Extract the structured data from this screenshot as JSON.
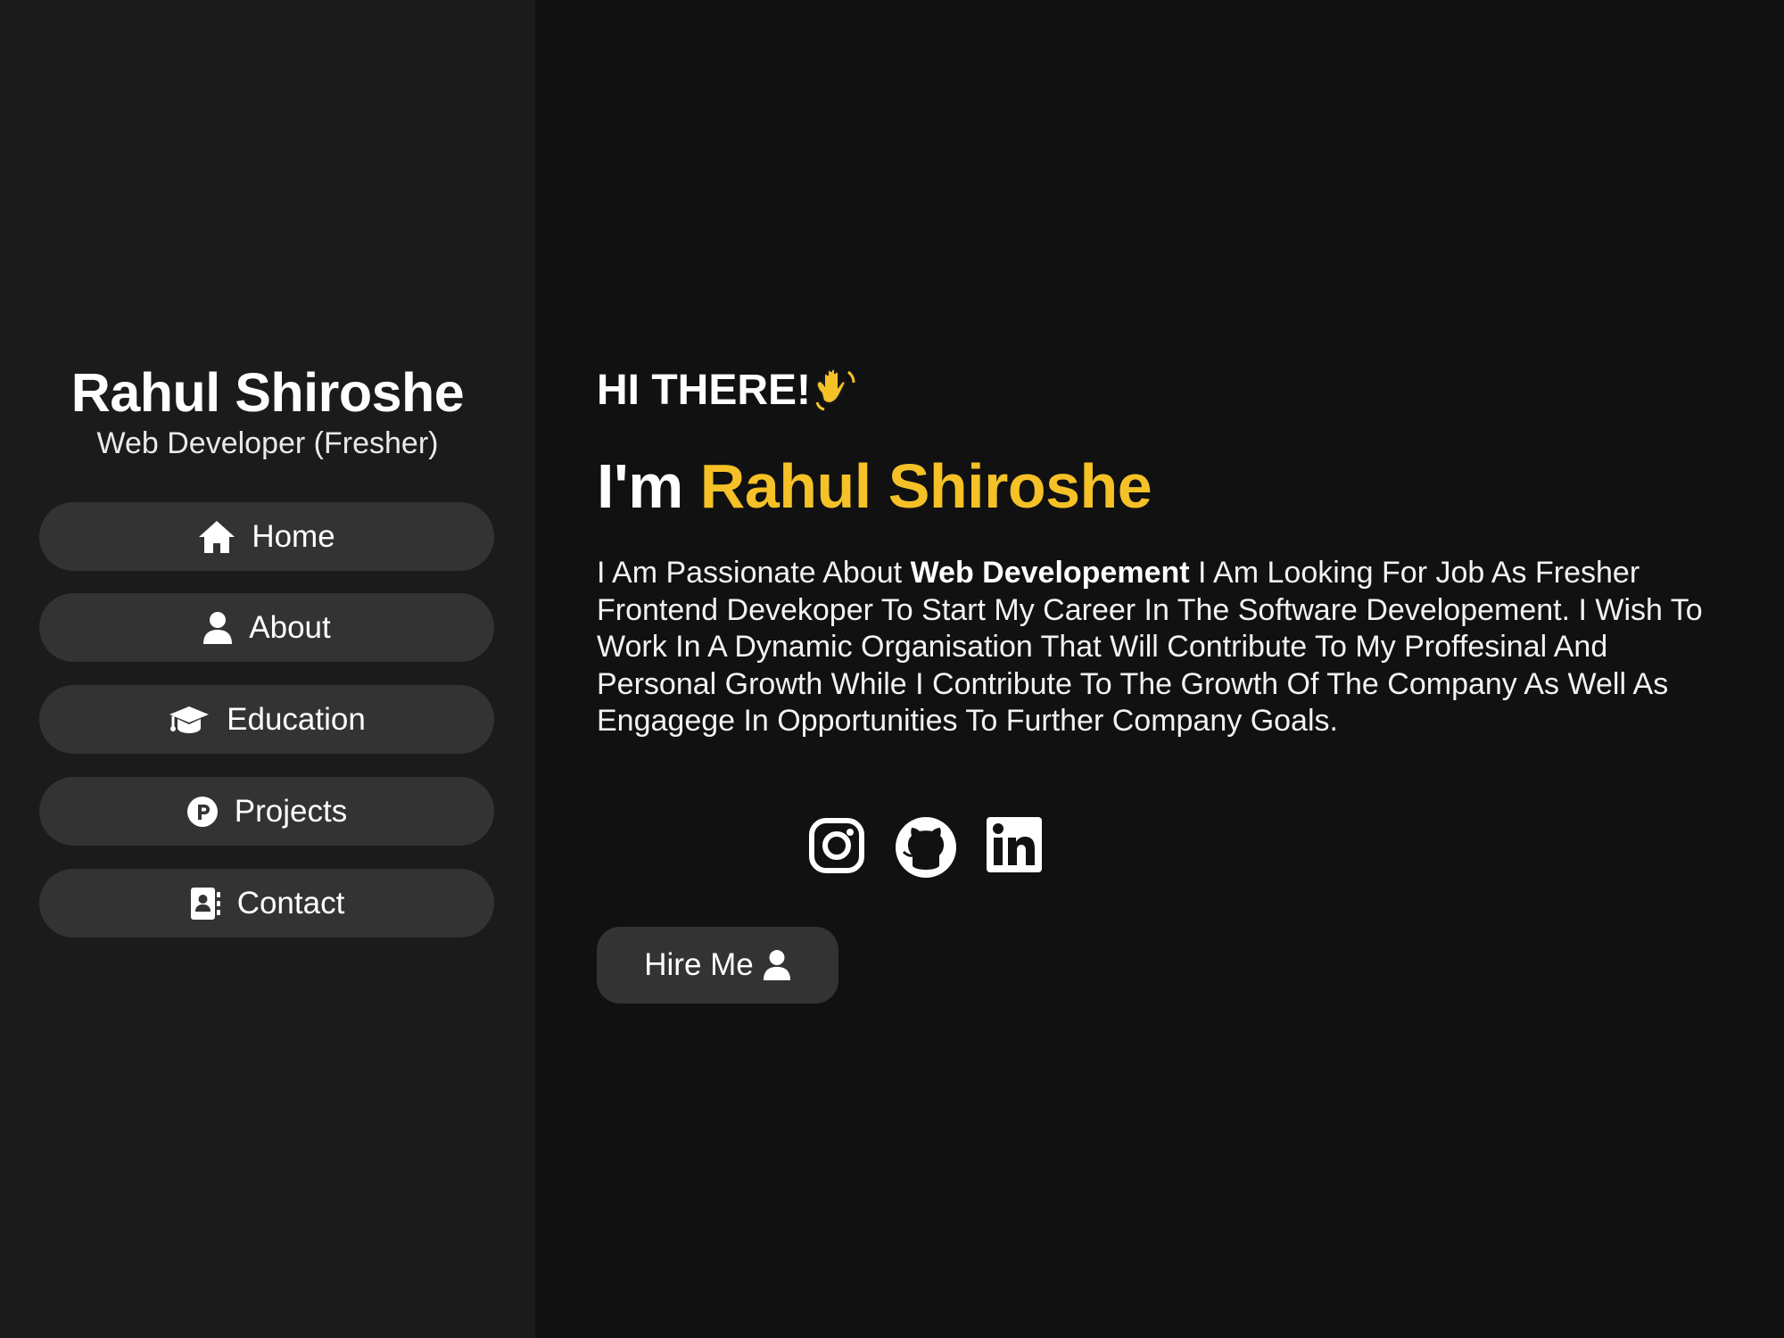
{
  "sidebar": {
    "name": "Rahul Shiroshe",
    "role": "Web Developer (Fresher)",
    "nav": [
      {
        "label": "Home",
        "icon": "home-icon"
      },
      {
        "label": "About",
        "icon": "user-icon"
      },
      {
        "label": "Education",
        "icon": "graduation-cap-icon"
      },
      {
        "label": "Projects",
        "icon": "product-p-icon"
      },
      {
        "label": "Contact",
        "icon": "address-book-icon"
      }
    ]
  },
  "main": {
    "greeting": "HI THERE!",
    "intro_prefix": "I'm",
    "intro_name": "Rahul Shiroshe",
    "about_part1": "I Am Passionate About",
    "about_bold": "Web Developement",
    "about_part2": "I Am Looking For Job As Fresher Frontend Devekoper To Start My Career In The Software Developement. I Wish To Work In A Dynamic Organisation That Will Contribute To My Proffesinal And Personal Growth While I Contribute To The Growth Of The Company As Well As Engagege In Opportunities To Further Company Goals.",
    "social": [
      "instagram-icon",
      "github-icon",
      "linkedin-icon"
    ],
    "hire_label": "Hire Me"
  },
  "colors": {
    "background": "#111111",
    "sidebar": "#1b1b1b",
    "button": "#333333",
    "accent": "#f5c126",
    "text": "#ffffff"
  }
}
